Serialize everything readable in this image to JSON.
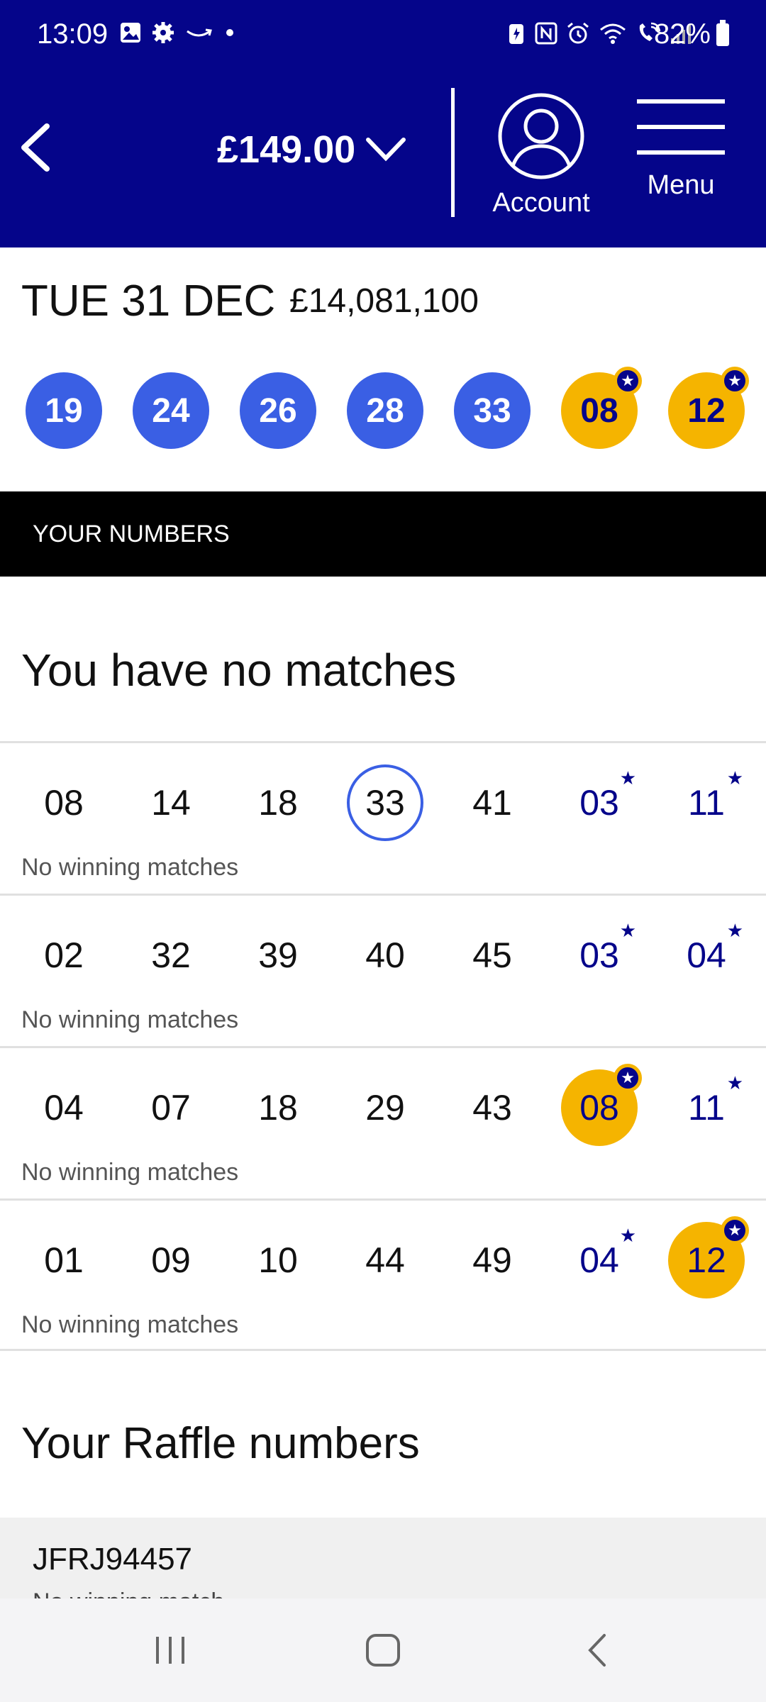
{
  "status_bar": {
    "time": "13:09",
    "battery": "82%",
    "left_icons": [
      "image-icon",
      "gear-icon",
      "amazon-icon",
      "dot-icon"
    ],
    "right_icons": [
      "battery-saver-icon",
      "nfc-icon",
      "alarm-icon",
      "wifi-icon",
      "wifi-calling-icon",
      "signal-icon"
    ]
  },
  "header": {
    "balance": "£149.00",
    "account_label": "Account",
    "menu_label": "Menu",
    "brand_color": "#05058a"
  },
  "draw": {
    "date": "TUE 31 DEC",
    "jackpot": "£14,081,100",
    "main_numbers": [
      "19",
      "24",
      "26",
      "28",
      "33"
    ],
    "lucky_stars": [
      "08",
      "12"
    ],
    "main_ball_color": "#3a5fe4",
    "star_ball_color": "#f5b400"
  },
  "your_numbers": {
    "section_label": "YOUR NUMBERS",
    "summary": "You have no matches",
    "lines": [
      {
        "main": [
          "08",
          "14",
          "18",
          "33",
          "41"
        ],
        "stars": [
          "03",
          "11"
        ],
        "caption": "No winning matches"
      },
      {
        "main": [
          "02",
          "32",
          "39",
          "40",
          "45"
        ],
        "stars": [
          "03",
          "04"
        ],
        "caption": "No winning matches"
      },
      {
        "main": [
          "04",
          "07",
          "18",
          "29",
          "43"
        ],
        "stars": [
          "08",
          "11"
        ],
        "caption": "No winning matches"
      },
      {
        "main": [
          "01",
          "09",
          "10",
          "44",
          "49"
        ],
        "stars": [
          "04",
          "12"
        ],
        "caption": "No winning matches"
      }
    ]
  },
  "raffle": {
    "title": "Your Raffle numbers",
    "code": "JFRJ94457",
    "status": "No winning match"
  },
  "nav": {
    "buttons": [
      "recents-icon",
      "home-icon",
      "back-icon"
    ]
  }
}
